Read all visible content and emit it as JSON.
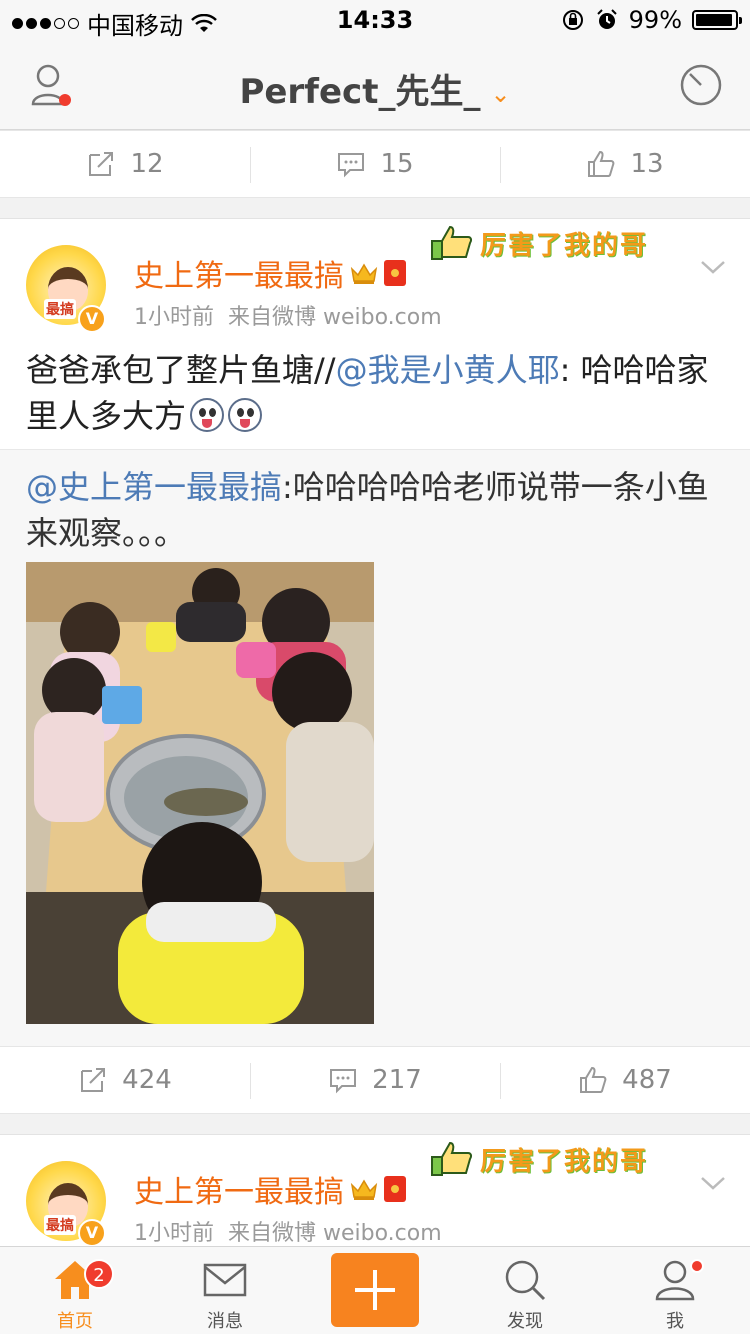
{
  "status_bar": {
    "carrier": "中国移动",
    "time": "14:33",
    "battery": "99%"
  },
  "header": {
    "title": "Perfect_先生_",
    "title_icon": "chevron-down-icon",
    "left_icon": "user-icon",
    "right_icon": "radar-icon"
  },
  "top_actions": {
    "repost": "12",
    "comment": "15",
    "like": "13"
  },
  "post": {
    "author": "史上第一最最搞",
    "avatar_tag": "最搞",
    "verified": "V",
    "sticker_text": "厉害了我的哥",
    "time": "1小时前",
    "source": "来自微博 weibo.com",
    "text_before": "爸爸承包了整片鱼塘//",
    "mention": "@我是小黄人耶",
    "text_after": ": 哈哈哈家里人多大方",
    "repost": {
      "mention": "@史上第一最最搞",
      "text": ":哈哈哈哈哈老师说带一条小鱼来观察。。。"
    },
    "actions": {
      "repost": "424",
      "comment": "217",
      "like": "487"
    }
  },
  "next_post": {
    "author": "史上第一最最搞",
    "avatar_tag": "最搞",
    "verified": "V",
    "sticker_text": "厉害了我的哥",
    "time": "1小时前",
    "source": "来自微博 weibo.com"
  },
  "tabbar": {
    "home": "首页",
    "home_badge": "2",
    "messages": "消息",
    "discover": "发现",
    "me": "我"
  },
  "colors": {
    "accent": "#f78e1e",
    "username": "#f06a12",
    "mention": "#4d7bb6"
  }
}
